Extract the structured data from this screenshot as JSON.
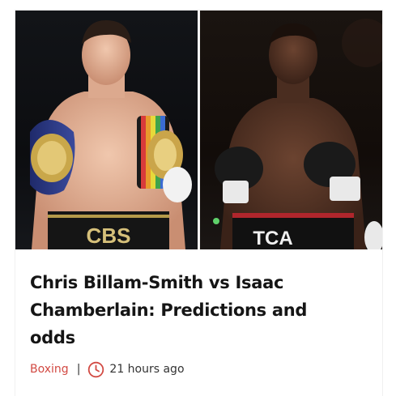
{
  "article": {
    "image_alt": "Chris Billam-Smith and Isaac Chamberlain",
    "title": "Chris Billam-Smith vs Isaac Chamberlain: Predictions and odds",
    "category": "Boxing",
    "separator": "|",
    "time": "21 hours ago",
    "clock_icon": "clock-icon"
  },
  "trunks": {
    "left": "CBS",
    "right": "TCA"
  },
  "colors": {
    "accent": "#d24a43",
    "title": "#151515"
  }
}
